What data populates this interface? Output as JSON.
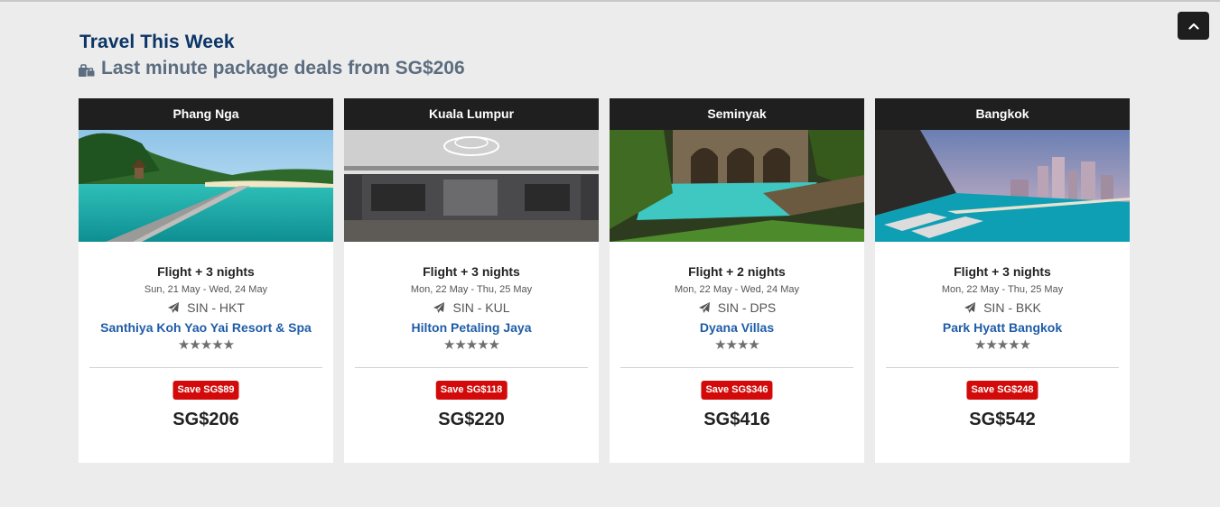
{
  "header": {
    "title": "Travel This Week",
    "subtitle": "Last minute package deals from SG$206",
    "subtitle_icon": "luggage-icon"
  },
  "scroll_top": {
    "icon": "chevron-up-icon"
  },
  "cards": [
    {
      "destination": "Phang Nga",
      "package": "Flight + 3 nights",
      "dates": "Sun, 21 May - Wed, 24 May",
      "route": "SIN - HKT",
      "hotel": "Santhiya Koh Yao Yai Resort & Spa",
      "stars": "★★★★★",
      "star_rating": 5,
      "save": "Save SG$89",
      "price": "SG$206"
    },
    {
      "destination": "Kuala Lumpur",
      "package": "Flight + 3 nights",
      "dates": "Mon, 22 May - Thu, 25 May",
      "route": "SIN - KUL",
      "hotel": "Hilton Petaling Jaya",
      "stars": "★★★★★",
      "star_rating": 5,
      "save": "Save SG$118",
      "price": "SG$220"
    },
    {
      "destination": "Seminyak",
      "package": "Flight + 2 nights",
      "dates": "Mon, 22 May - Wed, 24 May",
      "route": "SIN - DPS",
      "hotel": "Dyana Villas",
      "stars": "★★★★",
      "star_rating": 4,
      "save": "Save SG$346",
      "price": "SG$416"
    },
    {
      "destination": "Bangkok",
      "package": "Flight + 3 nights",
      "dates": "Mon, 22 May - Thu, 25 May",
      "route": "SIN - BKK",
      "hotel": "Park Hyatt Bangkok",
      "stars": "★★★★★",
      "star_rating": 5,
      "save": "Save SG$248",
      "price": "SG$542"
    }
  ],
  "colors": {
    "heading": "#0b3566",
    "subheading": "#5c6d80",
    "hotel_link": "#1f5ca8",
    "save_badge": "#d20a0a",
    "card_header": "#1f1f1f"
  }
}
